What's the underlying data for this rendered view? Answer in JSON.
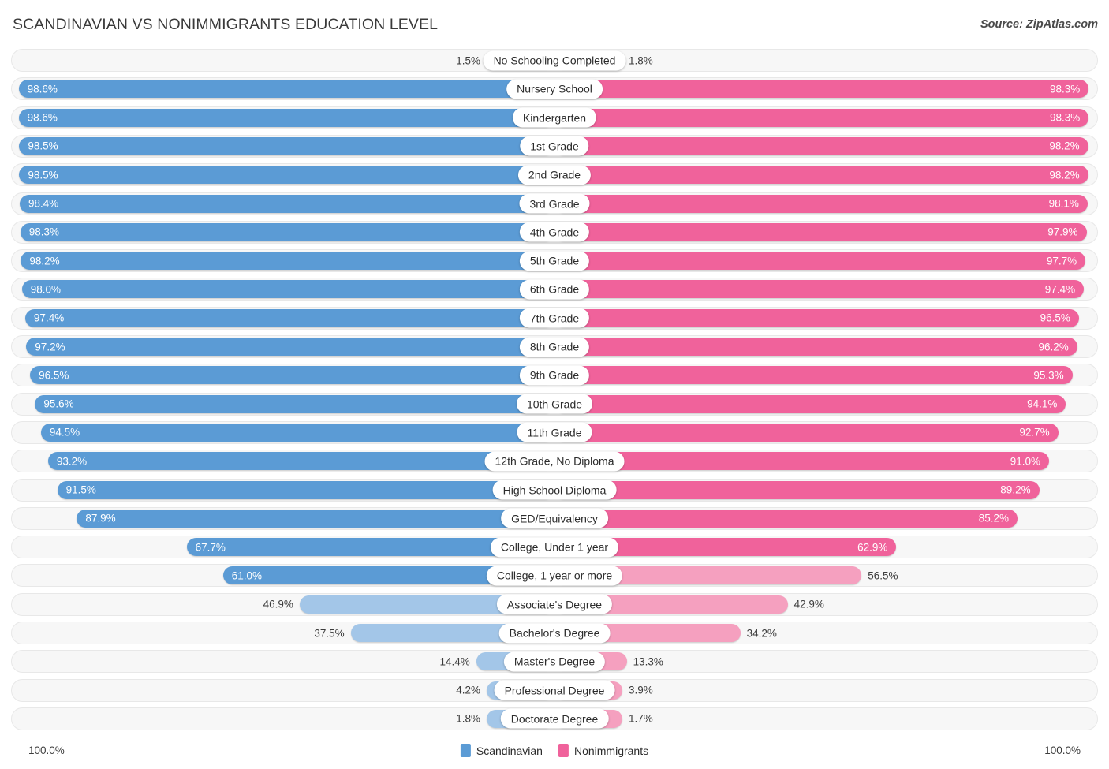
{
  "header": {
    "title": "SCANDINAVIAN VS NONIMMIGRANTS EDUCATION LEVEL",
    "source": "Source: ZipAtlas.com"
  },
  "footer": {
    "axis_left": "100.0%",
    "axis_right": "100.0%",
    "legend": [
      {
        "label": "Scandinavian",
        "color": "#5b9bd5"
      },
      {
        "label": "Nonimmigrants",
        "color": "#f0629b"
      }
    ]
  },
  "colors": {
    "left_strong": "#5b9bd5",
    "left_light": "#a3c6e8",
    "right_strong": "#f0629b",
    "right_light": "#f5a0bf",
    "track": "#f7f7f7",
    "track_border": "#e8e8e8"
  },
  "chart_data": {
    "type": "bar",
    "title": "SCANDINAVIAN VS NONIMMIGRANTS EDUCATION LEVEL",
    "xlabel": "",
    "ylabel": "",
    "xlim": [
      0,
      100
    ],
    "grid": false,
    "legend_position": "bottom-center",
    "orientation": "horizontal-diverging",
    "categories": [
      "No Schooling Completed",
      "Nursery School",
      "Kindergarten",
      "1st Grade",
      "2nd Grade",
      "3rd Grade",
      "4th Grade",
      "5th Grade",
      "6th Grade",
      "7th Grade",
      "8th Grade",
      "9th Grade",
      "10th Grade",
      "11th Grade",
      "12th Grade, No Diploma",
      "High School Diploma",
      "GED/Equivalency",
      "College, Under 1 year",
      "College, 1 year or more",
      "Associate's Degree",
      "Bachelor's Degree",
      "Master's Degree",
      "Professional Degree",
      "Doctorate Degree"
    ],
    "series": [
      {
        "name": "Scandinavian",
        "values": [
          1.5,
          98.6,
          98.6,
          98.5,
          98.5,
          98.4,
          98.3,
          98.2,
          98.0,
          97.4,
          97.2,
          96.5,
          95.6,
          94.5,
          93.2,
          91.5,
          87.9,
          67.7,
          61.0,
          46.9,
          37.5,
          14.4,
          4.2,
          1.8
        ],
        "labels": [
          "1.5%",
          "98.6%",
          "98.6%",
          "98.5%",
          "98.5%",
          "98.4%",
          "98.3%",
          "98.2%",
          "98.0%",
          "97.4%",
          "97.2%",
          "96.5%",
          "95.6%",
          "94.5%",
          "93.2%",
          "91.5%",
          "87.9%",
          "67.7%",
          "61.0%",
          "46.9%",
          "37.5%",
          "14.4%",
          "4.2%",
          "1.8%"
        ]
      },
      {
        "name": "Nonimmigrants",
        "values": [
          1.8,
          98.3,
          98.3,
          98.2,
          98.2,
          98.1,
          97.9,
          97.7,
          97.4,
          96.5,
          96.2,
          95.3,
          94.1,
          92.7,
          91.0,
          89.2,
          85.2,
          62.9,
          56.5,
          42.9,
          34.2,
          13.3,
          3.9,
          1.7
        ],
        "labels": [
          "1.8%",
          "98.3%",
          "98.3%",
          "98.2%",
          "98.2%",
          "98.1%",
          "97.9%",
          "97.7%",
          "97.4%",
          "96.5%",
          "96.2%",
          "95.3%",
          "94.1%",
          "92.7%",
          "91.0%",
          "89.2%",
          "85.2%",
          "62.9%",
          "56.5%",
          "42.9%",
          "34.2%",
          "13.3%",
          "3.9%",
          "1.7%"
        ]
      }
    ]
  }
}
